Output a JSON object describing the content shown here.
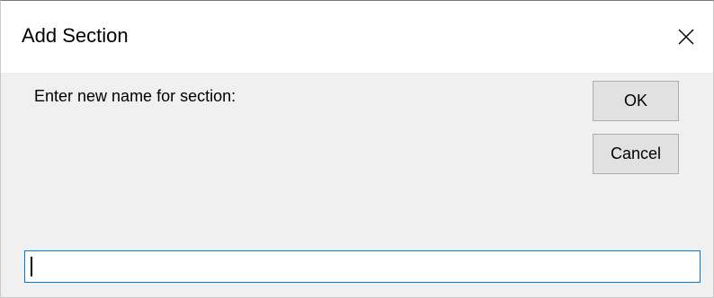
{
  "window": {
    "title": "Add Section"
  },
  "dialog": {
    "prompt": "Enter new name for section:",
    "ok_label": "OK",
    "cancel_label": "Cancel"
  },
  "name_input": {
    "value": ""
  },
  "icons": {
    "close": "close-icon"
  },
  "colors": {
    "focus_border": "#0078d7",
    "dialog_background": "#f0f0f0",
    "titlebar_background": "#ffffff",
    "button_background": "#e1e1e1"
  }
}
